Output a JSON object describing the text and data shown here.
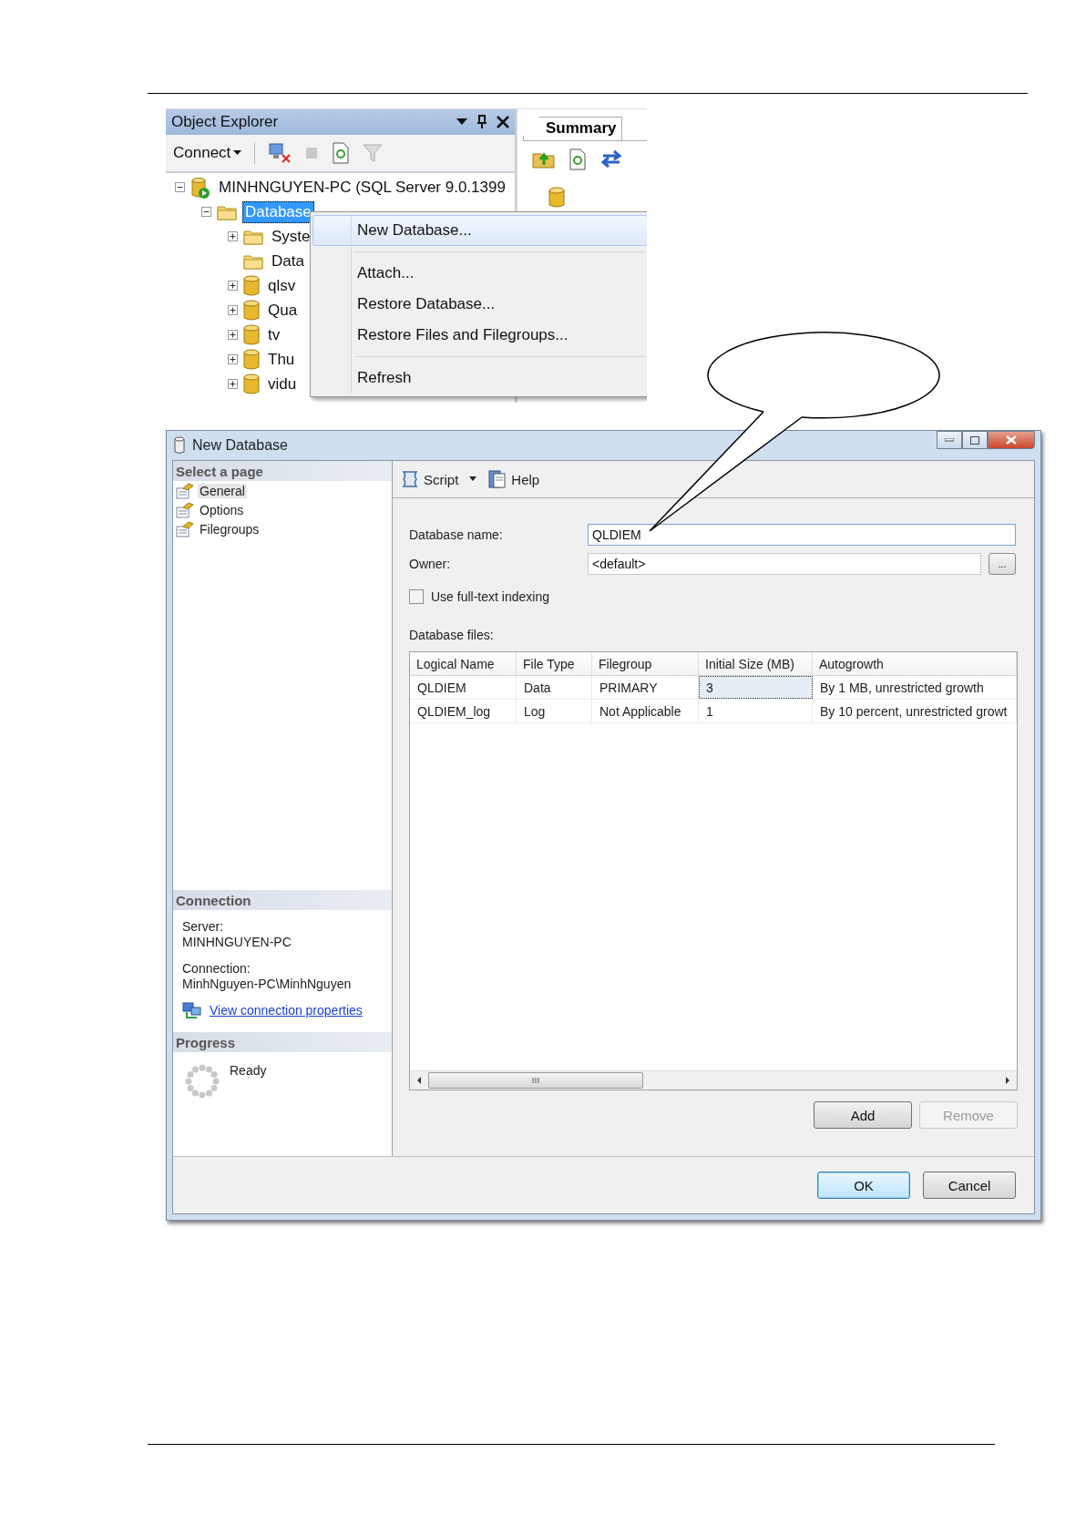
{
  "object_explorer": {
    "title": "Object Explorer",
    "connect_label": "Connect",
    "tree": [
      {
        "label": "MINHNGUYEN-PC (SQL Server 9.0.1399",
        "kind": "server",
        "expandable": true,
        "expanded": true,
        "selected": false,
        "children": [
          {
            "label": "Database",
            "kind": "folder",
            "expandable": true,
            "expanded": true,
            "selected": true,
            "children": [
              {
                "label": "Syste",
                "kind": "folder",
                "expandable": true,
                "expanded": false,
                "selected": false
              },
              {
                "label": "Data",
                "kind": "folder",
                "expandable": false,
                "selected": false
              },
              {
                "label": "qlsv",
                "kind": "database",
                "expandable": true,
                "expanded": false,
                "selected": false
              },
              {
                "label": "Qua",
                "kind": "database",
                "expandable": true,
                "expanded": false,
                "selected": false
              },
              {
                "label": "tv",
                "kind": "database",
                "expandable": true,
                "expanded": false,
                "selected": false
              },
              {
                "label": "Thu",
                "kind": "database",
                "expandable": true,
                "expanded": false,
                "selected": false
              },
              {
                "label": "vidu",
                "kind": "database",
                "expandable": true,
                "expanded": false,
                "selected": false
              }
            ]
          }
        ]
      }
    ]
  },
  "summary_tab": {
    "label": "Summary"
  },
  "context_menu": {
    "groups": [
      [
        {
          "label": "New Database...",
          "selected": true
        }
      ],
      [
        {
          "label": "Attach...",
          "selected": false
        },
        {
          "label": "Restore Database...",
          "selected": false
        },
        {
          "label": "Restore Files and Filegroups...",
          "selected": false
        }
      ],
      [
        {
          "label": "Refresh",
          "selected": false
        }
      ]
    ]
  },
  "dialog": {
    "title": "New Database",
    "pages_header": "Select a page",
    "pages": [
      {
        "label": "General",
        "selected": true
      },
      {
        "label": "Options",
        "selected": false
      },
      {
        "label": "Filegroups",
        "selected": false
      }
    ],
    "toolbar": [
      {
        "label": "Script",
        "kind": "script"
      },
      {
        "label": "Help",
        "kind": "help"
      }
    ],
    "fields": [
      {
        "label": "Database name:",
        "value": "QLDIEM",
        "browse": false
      },
      {
        "label": "Owner:",
        "value": "<default>",
        "browse": true
      }
    ],
    "browse_label": "...",
    "fulltext": {
      "label": "Use full-text indexing",
      "checked": false
    },
    "files": {
      "label": "Database files:",
      "columns": [
        "Logical Name",
        "File Type",
        "Filegroup",
        "Initial Size (MB)",
        "Autogrowth"
      ],
      "rows": [
        {
          "cells": [
            {
              "text": "QLDIEM",
              "focused": false
            },
            {
              "text": "Data",
              "focused": false
            },
            {
              "text": "PRIMARY",
              "focused": false
            },
            {
              "text": "3",
              "focused": true
            },
            {
              "text": "By 1 MB, unrestricted growth",
              "focused": false
            }
          ]
        },
        {
          "cells": [
            {
              "text": "QLDIEM_log",
              "focused": false
            },
            {
              "text": "Log",
              "focused": false
            },
            {
              "text": "Not Applicable",
              "focused": false
            },
            {
              "text": "1",
              "focused": false
            },
            {
              "text": "By 10 percent, unrestricted growt",
              "focused": false
            }
          ]
        }
      ]
    },
    "row_buttons": [
      {
        "label": "Add",
        "disabled": false
      },
      {
        "label": "Remove",
        "disabled": true
      }
    ],
    "connection": {
      "header": "Connection",
      "server_label": "Server:",
      "server": "MINHNGUYEN-PC",
      "connection_label": "Connection:",
      "connection": "MinhNguyen-PC\\MinhNguyen",
      "link": "View connection properties"
    },
    "progress": {
      "header": "Progress",
      "status": "Ready"
    },
    "buttons": [
      {
        "label": "OK",
        "default": true
      },
      {
        "label": "Cancel",
        "default": false
      }
    ]
  }
}
